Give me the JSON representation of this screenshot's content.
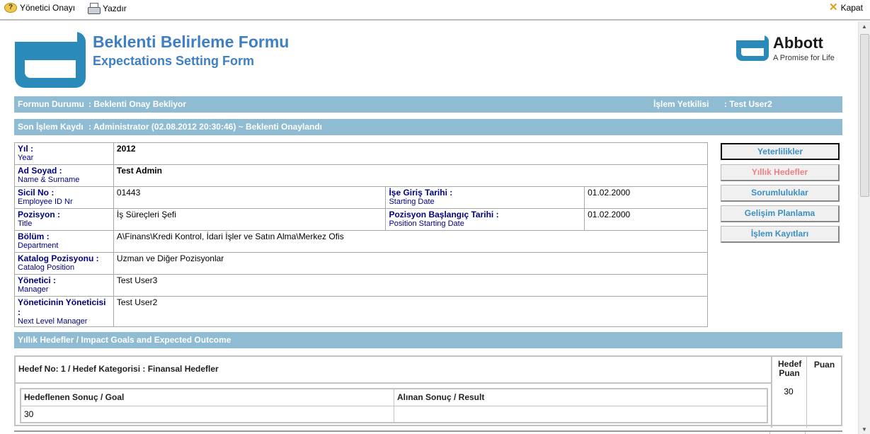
{
  "toolbar": {
    "approve_label": "Yönetici Onayı",
    "print_label": "Yazdır",
    "close_label": "Kapat",
    "icons": {
      "approve": "question-icon",
      "print": "printer-icon",
      "close": "close-x-icon"
    }
  },
  "header": {
    "title_tr": "Beklenti Belirleme Formu",
    "title_en": "Expectations Setting Form",
    "brand_name": "Abbott",
    "brand_tagline": "A Promise for Life"
  },
  "status": {
    "form_status_label": "Formun Durumu",
    "form_status_value": ": Beklenti Onay Bekliyor",
    "authority_label": "İşlem Yetkilisi",
    "authority_value": ": Test User2",
    "last_log_label": "Son İşlem Kaydı",
    "last_log_value": ": Administrator (02.08.2012 20:30:46) ~ Beklenti Onaylandı"
  },
  "info": {
    "year": {
      "label": "Yıl :",
      "sub": "Year",
      "value": "2012"
    },
    "name": {
      "label": "Ad Soyad :",
      "sub": "Name & Surname",
      "value": "Test Admin"
    },
    "sicil": {
      "label": "Sicil No :",
      "sub": "Employee ID Nr",
      "value": "01443"
    },
    "start": {
      "label": "İşe Giriş Tarihi :",
      "sub": "Starting Date",
      "value": "01.02.2000"
    },
    "position": {
      "label": "Pozisyon :",
      "sub": "Title",
      "value": "İş Süreçleri Şefi"
    },
    "pos_start": {
      "label": "Pozisyon Başlangıç Tarihi :",
      "sub": "Position Starting Date",
      "value": "01.02.2000"
    },
    "department": {
      "label": "Bölüm :",
      "sub": "Department",
      "value": "A\\Finans\\Kredi Kontrol, İdari İşler ve Satın Alma\\Merkez Ofis"
    },
    "catalog": {
      "label": "Katalog Pozisyonu :",
      "sub": "Catalog Position",
      "value": "Uzman ve Diğer Pozisyonlar"
    },
    "manager": {
      "label": "Yönetici :",
      "sub": "Manager",
      "value": "Test User3"
    },
    "next_manager": {
      "label": "Yöneticinin Yöneticisi :",
      "sub": "Next Level Manager",
      "value": "Test User2"
    }
  },
  "side_buttons": [
    "Yeterlilikler",
    "Yıllık Hedefler",
    "Sorumluluklar",
    "Gelişim Planlama",
    "İşlem Kayıtları"
  ],
  "goals": {
    "section_title": "Yıllık Hedefler / Impact Goals and Expected Outcome",
    "header": "Hedef No: 1 / Hedef Kategorisi : Finansal Hedefler",
    "col_target_points": "Hedef Puan",
    "col_points": "Puan",
    "target_points_value": "30",
    "goal_header": "Hedeflenen Sonuç / Goal",
    "result_header": "Alınan Sonuç / Result",
    "goal_value": "30",
    "result_value": ""
  },
  "colors": {
    "bar": "#8fbcd2",
    "title": "#3f7fc4",
    "label": "#000080",
    "button_text": "#3b8fc4",
    "disabled_button": "#f08080"
  }
}
